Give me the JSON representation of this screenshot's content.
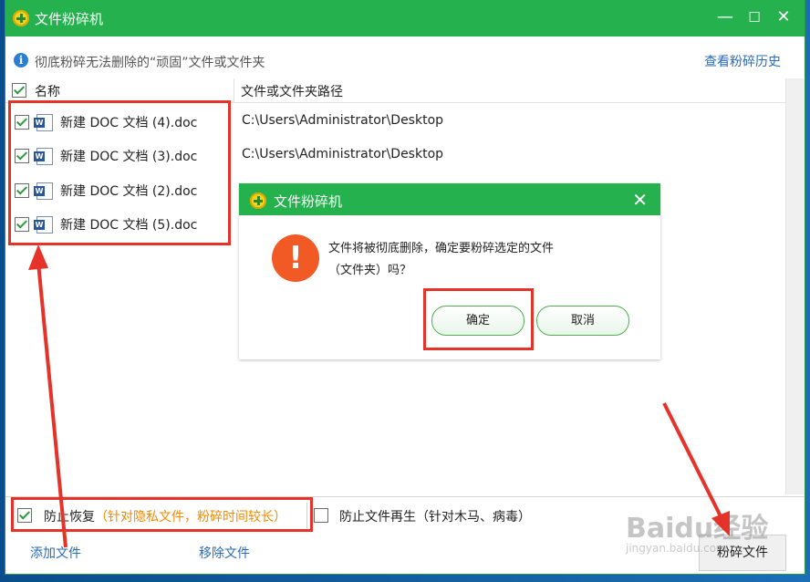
{
  "window": {
    "title": "文件粉碎机",
    "controls": {
      "minimize": "—",
      "maximize": "☐",
      "close": "✕"
    }
  },
  "info": {
    "icon": "info-icon",
    "text": "彻底粉碎无法删除的“顽固”文件或文件夹",
    "history_link": "查看粉碎历史"
  },
  "table": {
    "headers": {
      "name": "名称",
      "path": "文件或文件夹路径"
    },
    "rows": [
      {
        "name": "新建 DOC 文档 (4).doc",
        "path": "C:\\Users\\Administrator\\Desktop",
        "checked": true
      },
      {
        "name": "新建 DOC 文档 (3).doc",
        "path": "C:\\Users\\Administrator\\Desktop",
        "checked": true
      },
      {
        "name": "新建 DOC 文档 (2).doc",
        "path": "",
        "checked": true
      },
      {
        "name": "新建 DOC 文档 (5).doc",
        "path": "",
        "checked": true
      }
    ]
  },
  "options": {
    "prevent_recovery": {
      "label": "防止恢复",
      "note": "（针对隐私文件，粉碎时间较长）",
      "checked": true
    },
    "prevent_regen": {
      "label": "防止文件再生（针对木马、病毒）",
      "checked": false
    }
  },
  "footer": {
    "add_file": "添加文件",
    "remove_file": "移除文件",
    "shred_button": "粉碎文件"
  },
  "dialog": {
    "title": "文件粉碎机",
    "icon": "warning-icon",
    "message_line1": "文件将被彻底删除，确定要粉碎选定的文件",
    "message_line2": "（文件夹）吗？",
    "ok_label": "确定",
    "cancel_label": "取消"
  },
  "watermark": {
    "main": "Baidu经验",
    "sub": "jingyan.baidu.com"
  },
  "colors": {
    "titlebar": "#25b14d",
    "accent_link": "#2a6bb8",
    "highlight": "#e5332a",
    "warning": "#f15a24",
    "note": "#f08a00"
  }
}
